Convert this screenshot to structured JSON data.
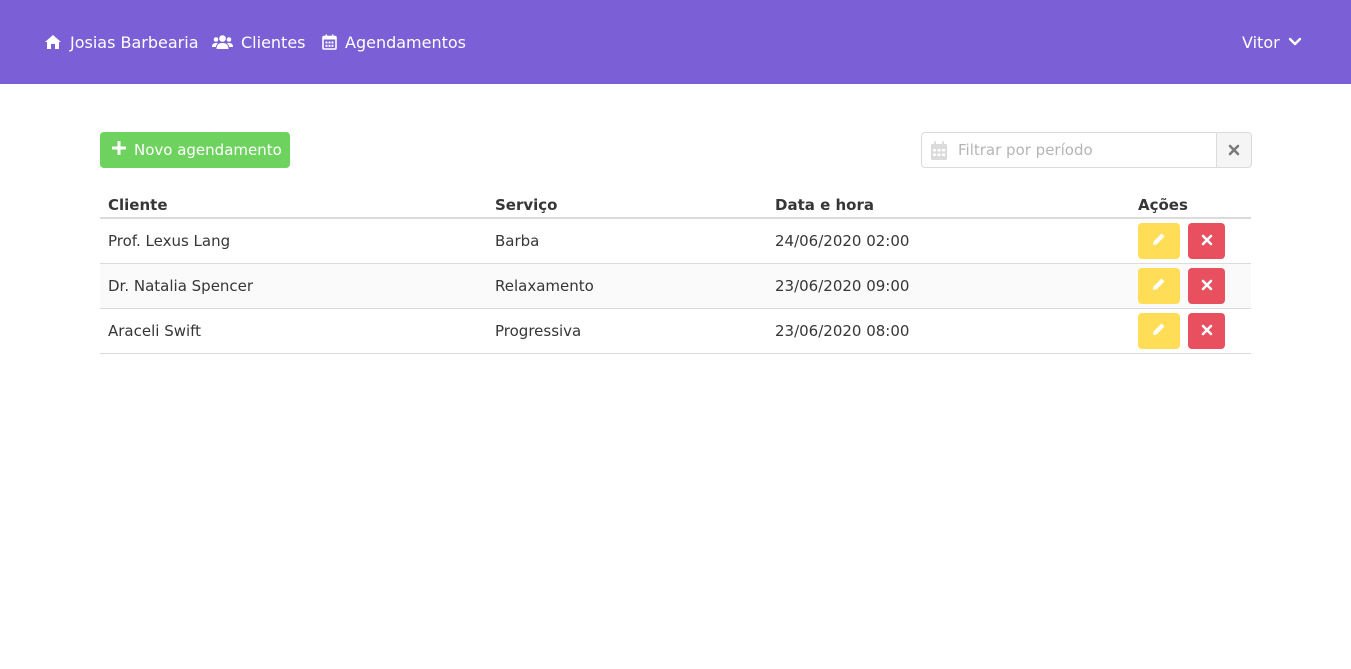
{
  "nav": {
    "home_label": "Josias Barbearia",
    "clientes_label": "Clientes",
    "agendamentos_label": "Agendamentos",
    "user_label": "Vitor",
    "icons": [
      "home-icon",
      "users-icon",
      "calendar-icon",
      "chevron-down-icon"
    ]
  },
  "toolbar": {
    "new_label": "Novo agendamento",
    "filter_placeholder": "Filtrar por período",
    "filter_value": ""
  },
  "table": {
    "headers": [
      "Cliente",
      "Serviço",
      "Data e hora",
      "Ações"
    ],
    "rows": [
      {
        "cliente": "Prof. Lexus Lang",
        "servico": "Barba",
        "data_hora": "24/06/2020 02:00"
      },
      {
        "cliente": "Dr. Natalia Spencer",
        "servico": "Relaxamento",
        "data_hora": "23/06/2020 09:00"
      },
      {
        "cliente": "Araceli Swift",
        "servico": "Progressiva",
        "data_hora": "23/06/2020 08:00"
      }
    ]
  },
  "colors": {
    "navbar": "#7b5fd6",
    "success": "#6dd35e",
    "warning": "#ffdd57",
    "danger": "#e8505f"
  }
}
